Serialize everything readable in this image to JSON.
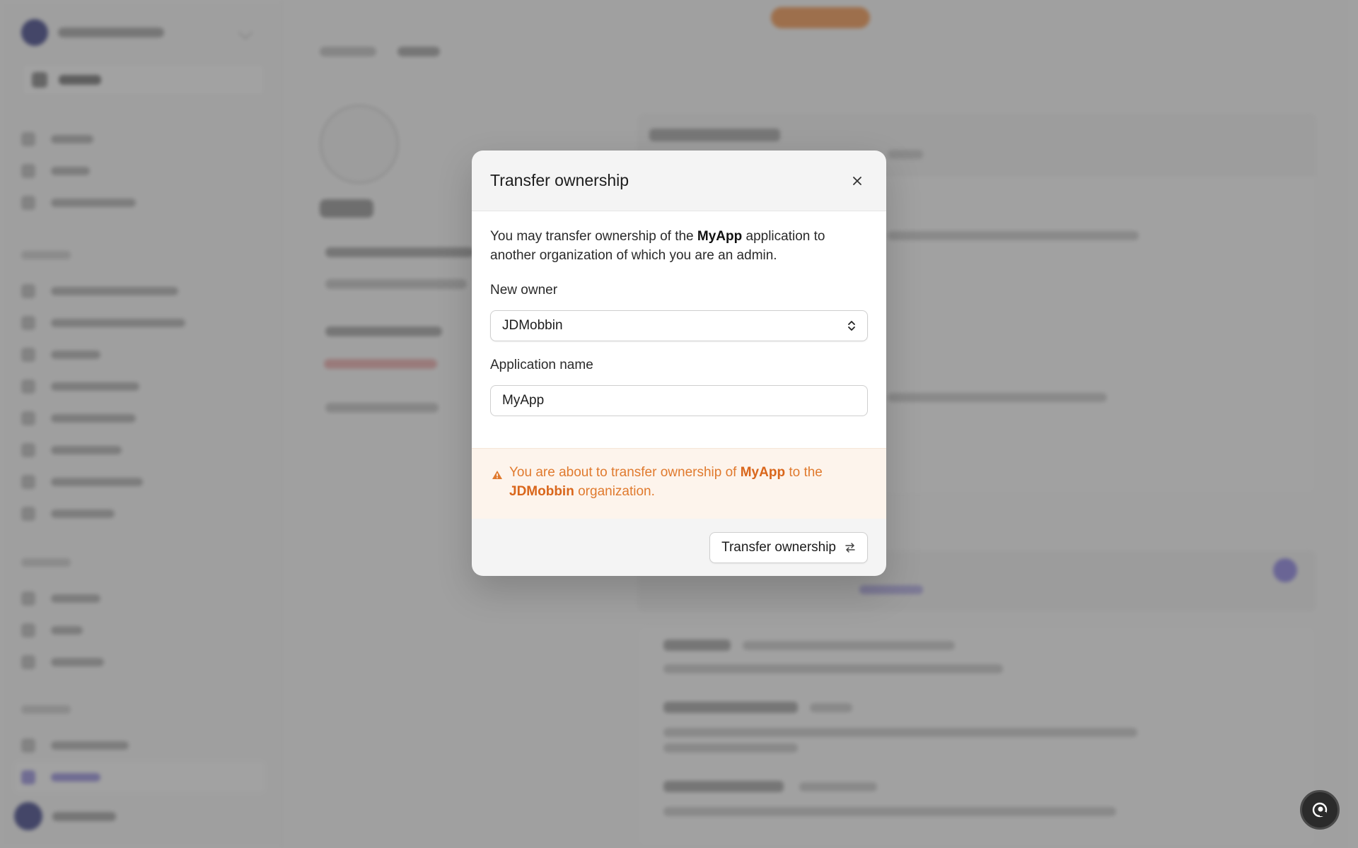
{
  "modal": {
    "title": "Transfer ownership",
    "intro_pre": "You may transfer ownership of the ",
    "intro_app": "MyApp",
    "intro_post": " application to another organization of which you are an admin.",
    "new_owner_label": "New owner",
    "new_owner_value": "JDMobbin",
    "app_name_label": "Application name",
    "app_name_value": "MyApp",
    "warning_pre": "You are about to transfer ownership of ",
    "warning_app": "MyApp",
    "warning_mid": " to the ",
    "warning_org": "JDMobbin",
    "warning_post": " organization.",
    "submit_label": "Transfer ownership"
  },
  "icons": {
    "close": "close-icon",
    "select": "chevron-up-down-icon",
    "warning": "warning-triangle-icon",
    "transfer": "arrows-swap-icon",
    "help": "help-fab-icon"
  },
  "colors": {
    "warning_text": "#e07a2e",
    "warning_bg": "#fdf4ec",
    "accent": "#7e74de"
  }
}
